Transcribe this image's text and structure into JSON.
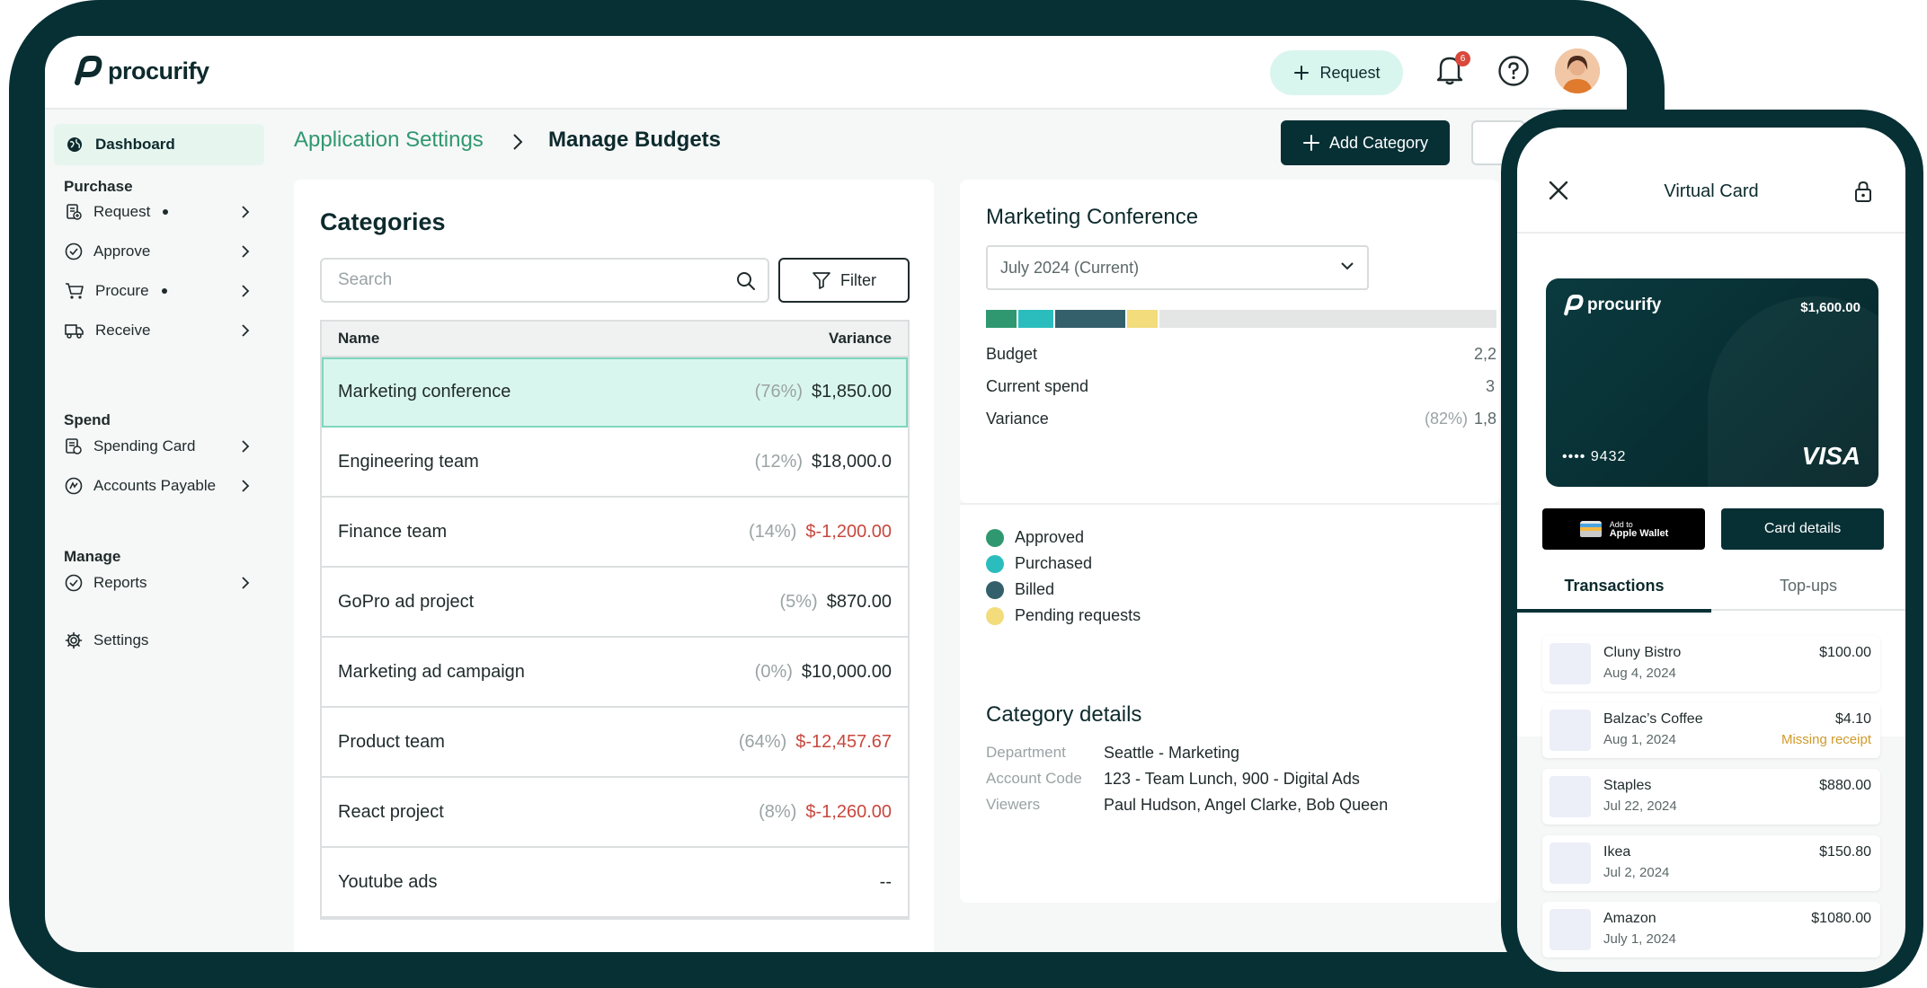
{
  "app": {
    "logo_text": "procurify"
  },
  "topbar": {
    "request_label": "Request",
    "notification_count": "6"
  },
  "sidebar": {
    "dashboard": "Dashboard",
    "sections": [
      {
        "title": "Purchase",
        "items": [
          {
            "label": "Request",
            "dot": true
          },
          {
            "label": "Approve",
            "dot": false
          },
          {
            "label": "Procure",
            "dot": true
          },
          {
            "label": "Receive",
            "dot": false
          }
        ]
      },
      {
        "title": "Spend",
        "items": [
          {
            "label": "Spending Card"
          },
          {
            "label": "Accounts Payable"
          }
        ]
      },
      {
        "title": "Manage",
        "items": [
          {
            "label": "Reports"
          }
        ]
      }
    ],
    "settings": "Settings"
  },
  "breadcrumb": {
    "parent": "Application Settings",
    "current": "Manage Budgets"
  },
  "actions": {
    "add_category": "Add Category"
  },
  "categories": {
    "title": "Categories",
    "search_placeholder": "Search",
    "filter_label": "Filter",
    "columns": [
      "Name",
      "Variance"
    ],
    "rows": [
      {
        "name": "Marketing conference",
        "pct": "(76%)",
        "amount": "$1,850.00",
        "negative": false,
        "selected": true
      },
      {
        "name": "Engineering team",
        "pct": "(12%)",
        "amount": "$18,000.0",
        "negative": false
      },
      {
        "name": "Finance team",
        "pct": "(14%)",
        "amount": "$-1,200.00",
        "negative": true
      },
      {
        "name": "GoPro ad project",
        "pct": "(5%)",
        "amount": "$870.00",
        "negative": false
      },
      {
        "name": "Marketing ad campaign",
        "pct": "(0%)",
        "amount": "$10,000.00",
        "negative": false
      },
      {
        "name": "Product team",
        "pct": "(64%)",
        "amount": "$-12,457.67",
        "negative": true
      },
      {
        "name": "React project",
        "pct": "(8%)",
        "amount": "$-1,260.00",
        "negative": true
      },
      {
        "name": "Youtube ads",
        "pct": "",
        "amount": "--",
        "negative": false
      }
    ]
  },
  "detail": {
    "title": "Marketing Conference",
    "period": "July 2024 (Current)",
    "spend_bar": [
      {
        "status": "Approved",
        "fraction": 0.06,
        "color": "#2f9870"
      },
      {
        "status": "Purchased",
        "fraction": 0.07,
        "color": "#2bbdbd"
      },
      {
        "status": "Billed",
        "fraction": 0.14,
        "color": "#33606a"
      },
      {
        "status": "Pending requests",
        "fraction": 0.06,
        "color": "#f2dc7c"
      }
    ],
    "budget_label": "Budget",
    "budget_value": "2,2",
    "current_spend_label": "Current spend",
    "current_spend_value": "3",
    "variance_label": "Variance",
    "variance_pct": "(82%)",
    "variance_value": "1,8",
    "legend": [
      {
        "label": "Approved",
        "color": "#2f9870"
      },
      {
        "label": "Purchased",
        "color": "#2bbdbd"
      },
      {
        "label": "Billed",
        "color": "#33606a"
      },
      {
        "label": "Pending requests",
        "color": "#f2dc7c"
      }
    ]
  },
  "category_details": {
    "title": "Category details",
    "department_label": "Department",
    "department_value": "Seattle - Marketing",
    "account_label": "Account Code",
    "account_value": "123 - Team Lunch,  900 - Digital Ads",
    "viewers_label": "Viewers",
    "viewers_value": "Paul Hudson, Angel Clarke, Bob Queen"
  },
  "phone": {
    "title": "Virtual Card",
    "card": {
      "logo": "procurify",
      "amount": "$1,600.00",
      "number": "•••• 9432",
      "brand": "VISA"
    },
    "wallet_small": "Add to",
    "wallet_big": "Apple Wallet",
    "details_label": "Card details",
    "tabs": [
      "Transactions",
      "Top-ups"
    ],
    "transactions": [
      {
        "name": "Cluny Bistro",
        "date": "Aug 4, 2024",
        "amount": "$100.00",
        "note": ""
      },
      {
        "name": "Balzac’s Coffee",
        "date": "Aug 1, 2024",
        "amount": "$4.10",
        "note": "Missing receipt"
      },
      {
        "name": "Staples",
        "date": "Jul 22, 2024",
        "amount": "$880.00",
        "note": ""
      },
      {
        "name": "Ikea",
        "date": "Jul 2, 2024",
        "amount": "$150.80",
        "note": ""
      },
      {
        "name": "Amazon",
        "date": "July 1, 2024",
        "amount": "$1080.00",
        "note": ""
      }
    ]
  }
}
